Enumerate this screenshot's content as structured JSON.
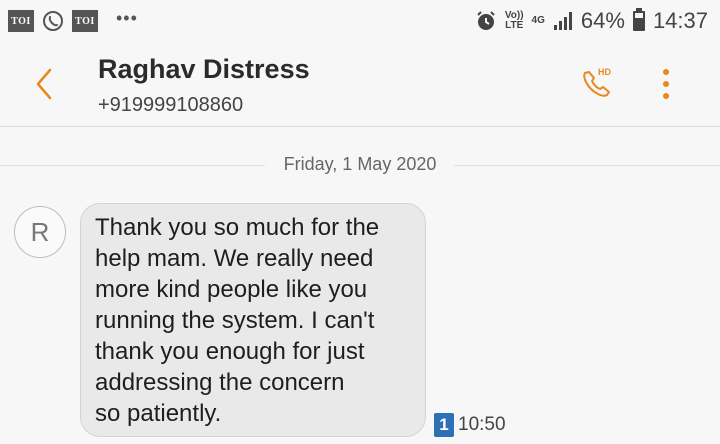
{
  "status_bar": {
    "notif_1": "TOI",
    "notif_2": "TOI",
    "more_notifs": "•••",
    "volte": "Vo))",
    "lte": "LTE",
    "network": "4G",
    "battery_percent": "64%",
    "time": "14:37"
  },
  "header": {
    "contact_name": "Raghav Distress",
    "contact_number": "+919999108860",
    "call_badge": "HD"
  },
  "conversation": {
    "date": "Friday, 1 May 2020",
    "messages": [
      {
        "avatar_letter": "R",
        "lines": [
          "Thank you so much for the",
          "help mam. We really need",
          "more kind people like you",
          "running the system. I can't",
          "thank you enough for just",
          "addressing the concern",
          "so patiently."
        ],
        "sim": "1",
        "time": "10:50"
      }
    ]
  },
  "colors": {
    "accent": "#e8891f",
    "sim_badge": "#2e6fb5",
    "bubble": "#e9e9e9"
  }
}
